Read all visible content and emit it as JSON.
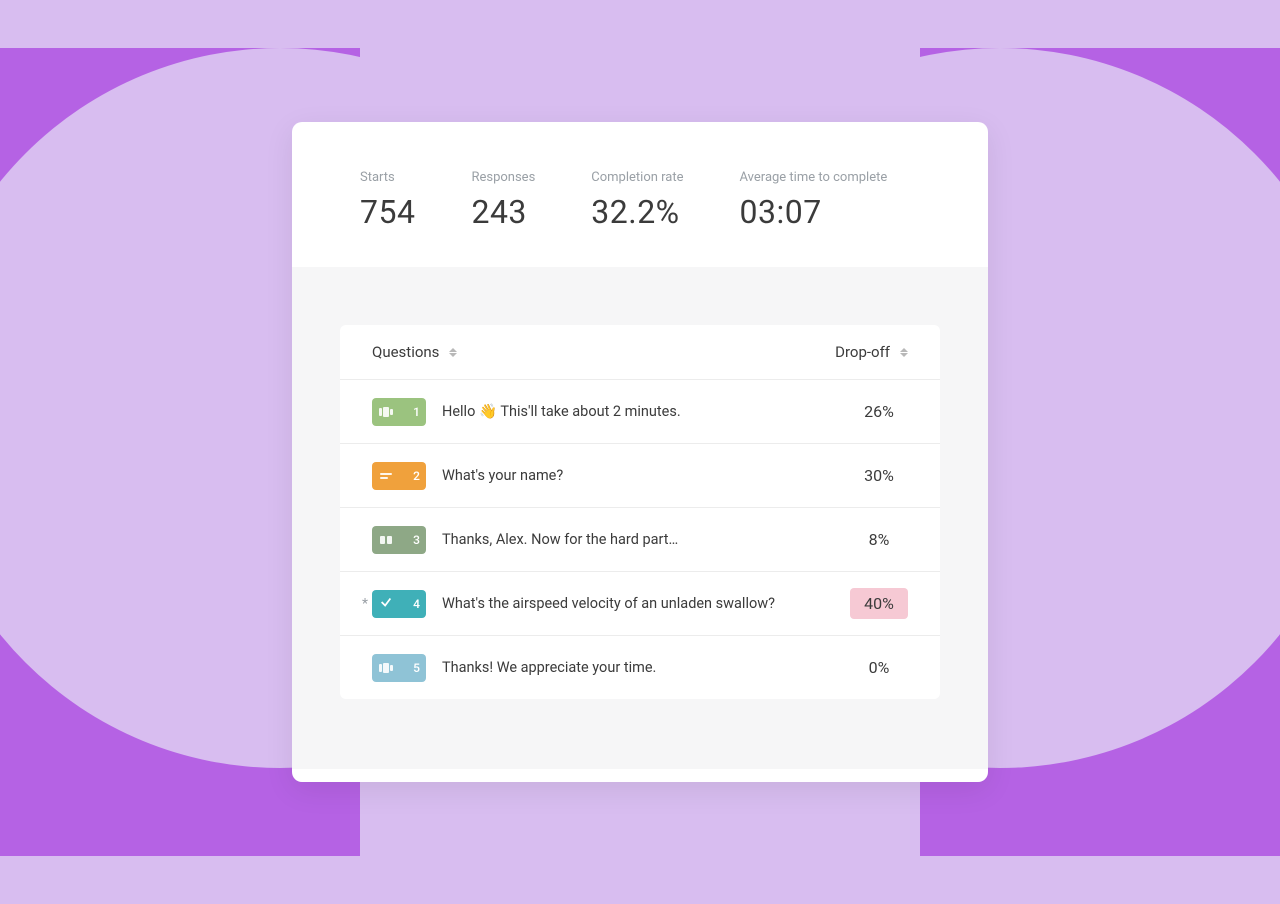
{
  "stats": {
    "starts": {
      "label": "Starts",
      "value": "754"
    },
    "responses": {
      "label": "Responses",
      "value": "243"
    },
    "completion": {
      "label": "Completion rate",
      "value": "32.2%"
    },
    "avg_time": {
      "label": "Average time to complete",
      "value": "03:07"
    }
  },
  "table": {
    "header_questions": "Questions",
    "header_dropoff": "Drop-off"
  },
  "rows": [
    {
      "num": "1",
      "badge_color": "bg-green",
      "icon": "slides",
      "text_pre": "Hello ",
      "emoji": "👋",
      "text_post": " This'll take about 2 minutes.",
      "dropoff": "26%",
      "highlight": false,
      "marker": ""
    },
    {
      "num": "2",
      "badge_color": "bg-orange",
      "icon": "lines",
      "text_pre": "What's your name?",
      "emoji": "",
      "text_post": "",
      "dropoff": "30%",
      "highlight": false,
      "marker": ""
    },
    {
      "num": "3",
      "badge_color": "bg-sage",
      "icon": "quote",
      "text_pre": "Thanks, Alex. Now for the hard part…",
      "emoji": "",
      "text_post": "",
      "dropoff": "8%",
      "highlight": false,
      "marker": ""
    },
    {
      "num": "4",
      "badge_color": "bg-teal",
      "icon": "check",
      "text_pre": "What's the airspeed velocity of an unladen swallow?",
      "emoji": "",
      "text_post": "",
      "dropoff": "40%",
      "highlight": true,
      "marker": "*"
    },
    {
      "num": "5",
      "badge_color": "bg-blue",
      "icon": "slides",
      "text_pre": "Thanks! We appreciate your time.",
      "emoji": "",
      "text_post": "",
      "dropoff": "0%",
      "highlight": false,
      "marker": ""
    }
  ]
}
